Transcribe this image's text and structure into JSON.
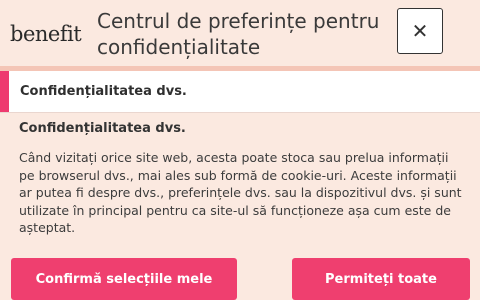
{
  "header": {
    "logo_text": "benefit",
    "title": "Centrul de preferințe pentru confidențialitate",
    "close_symbol": "✕"
  },
  "section": {
    "label": "Confidențialitatea dvs."
  },
  "content": {
    "heading": "Confidențialitatea dvs.",
    "body": "Când vizitați orice site web, acesta poate stoca sau prelua informații pe browserul dvs., mai ales sub formă de cookie-uri. Aceste informații ar putea fi despre dvs., preferințele dvs. sau la dispozitivul dvs. și sunt utilizate în principal pentru ca site-ul să funcționeze așa cum este de așteptat."
  },
  "buttons": {
    "confirm": "Confirmă selecțiile mele",
    "allow_all": "Permiteți toate"
  },
  "colors": {
    "accent": "#ef3f6f",
    "background": "#fbe9e0"
  }
}
